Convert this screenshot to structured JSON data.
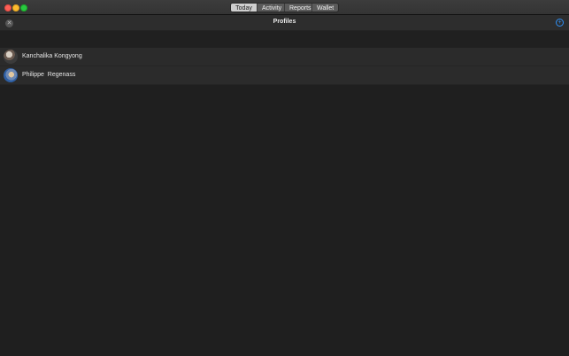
{
  "titlebar": {
    "tabs": [
      {
        "label": "Today",
        "active": true
      },
      {
        "label": "Activity",
        "active": false
      },
      {
        "label": "Reports",
        "active": false
      },
      {
        "label": "Wallet",
        "active": false
      }
    ]
  },
  "header": {
    "title": "Profiles",
    "close_icon": "close-icon",
    "add_icon": "plus-circle-icon"
  },
  "profiles": [
    {
      "name": "Kanchalika Kongyong",
      "avatar": "avatar-photo"
    },
    {
      "name": "Philippe  Regenass",
      "avatar": "avatar-photo"
    }
  ],
  "colors": {
    "accent": "#2f8ff5",
    "background": "#1f1f1f",
    "row": "#2b2b2b"
  }
}
